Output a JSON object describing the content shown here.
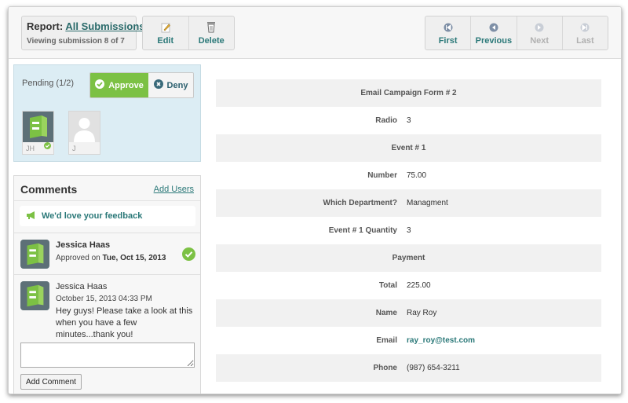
{
  "header": {
    "report_prefix": "Report:",
    "report_link": "All Submissions",
    "viewing": "Viewing submission 8 of 7"
  },
  "actions": {
    "edit": "Edit",
    "delete": "Delete"
  },
  "navigation": {
    "first": "First",
    "previous": "Previous",
    "next": "Next",
    "last": "Last"
  },
  "approval": {
    "pending": "Pending (1/2)",
    "approve": "Approve",
    "deny": "Deny",
    "approvers": [
      {
        "initials": "JH",
        "approved": true
      },
      {
        "initials": "J",
        "approved": false
      }
    ]
  },
  "comments": {
    "title": "Comments",
    "add_users": "Add Users",
    "feedback": "We'd love your feedback",
    "entries": [
      {
        "name": "Jessica Haas",
        "meta_prefix": "Approved on",
        "meta_date": "Tue, Oct 15, 2013"
      },
      {
        "name": "Jessica Haas",
        "meta": "October 15, 2013 04:33 PM",
        "body": "Hey guys! Please take a look at this when you have a few minutes...thank you!"
      }
    ],
    "add_comment": "Add Comment"
  },
  "form": {
    "rows": [
      {
        "section": "Email Campaign Form # 2"
      },
      {
        "label": "Radio",
        "value": "3"
      },
      {
        "section": "Event # 1"
      },
      {
        "label": "Number",
        "value": "75.00"
      },
      {
        "label": "Which Department?",
        "value": "Managment"
      },
      {
        "label": "Event # 1 Quantity",
        "value": "3"
      },
      {
        "section": "Payment"
      },
      {
        "label": "Total",
        "value": "225.00"
      },
      {
        "label": "Name",
        "value": "Ray Roy"
      },
      {
        "label": "Email",
        "value": "ray_roy@test.com"
      },
      {
        "label": "Phone",
        "value": "(987) 654-3211"
      }
    ]
  },
  "colors": {
    "accent": "#2a7878",
    "approve_green": "#7cc144",
    "pending_bg": "#dcedf4"
  }
}
